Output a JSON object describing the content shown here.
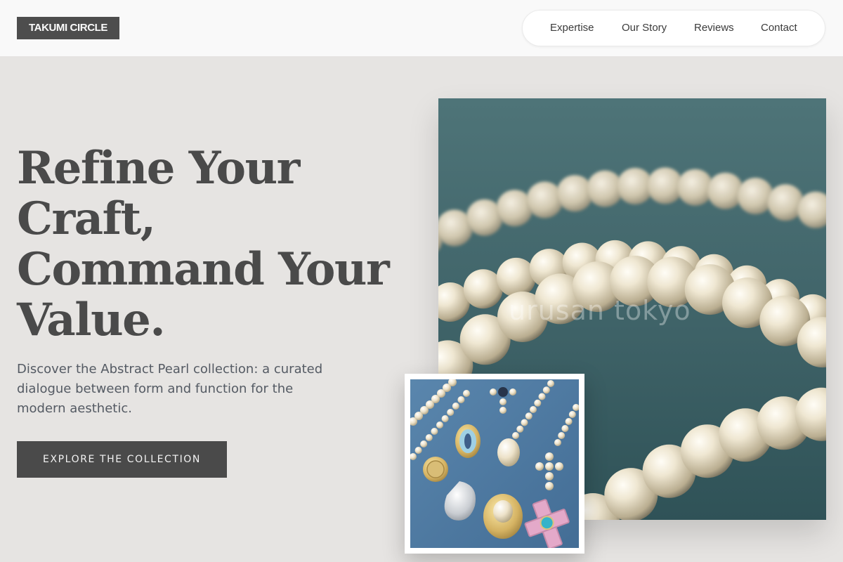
{
  "brand": {
    "logo_text": "TAKUMI CIRCLE"
  },
  "nav": {
    "items": [
      {
        "label": "Expertise"
      },
      {
        "label": "Our Story"
      },
      {
        "label": "Reviews"
      },
      {
        "label": "Contact"
      }
    ]
  },
  "hero": {
    "title_lines": [
      "Refine Your",
      "Craft,",
      "Command Your",
      "Value."
    ],
    "subtitle": "Discover the Abstract Pearl collection: a curated dialogue between form and function for the modern aesthetic.",
    "cta_label": "EXPLORE THE COLLECTION"
  },
  "images": {
    "main": {
      "subject": "pearl necklace on teal fabric",
      "watermark": "urusan tokyo"
    },
    "inset": {
      "subject": "pearl and enamel charms on denim"
    }
  },
  "colors": {
    "page_bg": "#e6e4e2",
    "header_bg": "#f9f9f9",
    "logo_bg": "#4d4d4d",
    "button_bg": "#4a4a4a",
    "heading": "#4a4a4a",
    "teal": "#3f6468",
    "denim": "#4f7aa3"
  }
}
